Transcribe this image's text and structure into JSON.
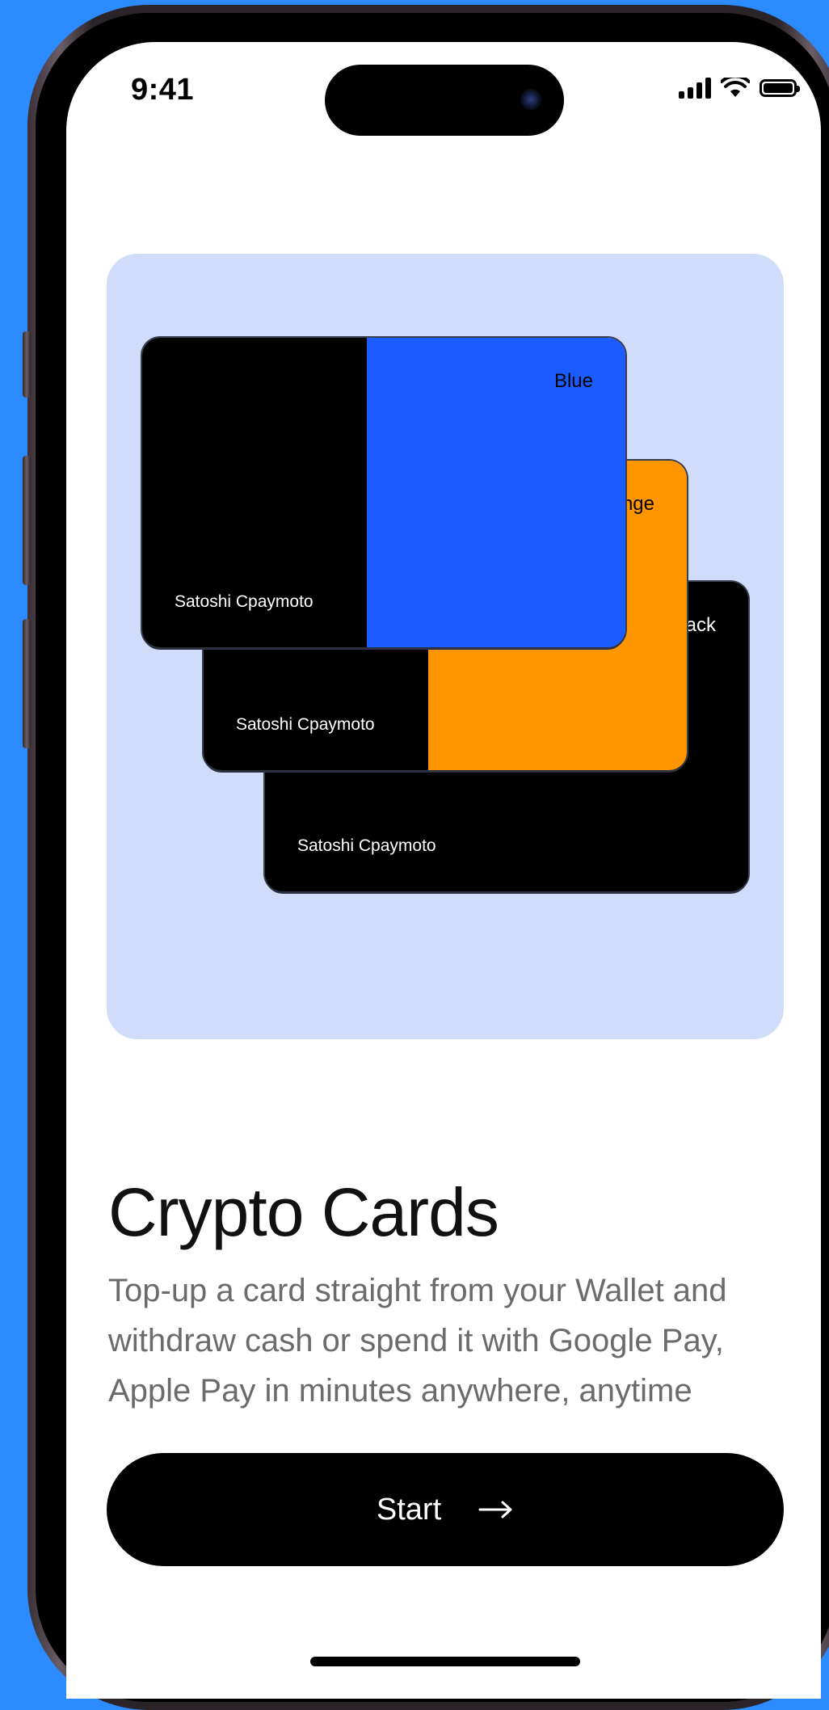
{
  "status": {
    "time": "9:41"
  },
  "hero": {
    "cards": [
      {
        "label": "Blue",
        "holder": "Satoshi Cpaymoto",
        "color": "#1a5cff"
      },
      {
        "label": "Orange",
        "holder": "Satoshi Cpaymoto",
        "color": "#ff9500"
      },
      {
        "label": "Black",
        "holder": "Satoshi Cpaymoto",
        "color": "#000000"
      }
    ]
  },
  "main": {
    "title": "Crypto Cards",
    "description": "Top-up a card straight from your Wallet and withdraw cash or spend it with Google Pay, Apple Pay in minutes anywhere, anytime"
  },
  "cta": {
    "label": "Start",
    "icon": "arrow-right-icon"
  },
  "colors": {
    "background": "#2b8bff",
    "hero_bg": "#d0dcfa",
    "button": "#000000"
  }
}
